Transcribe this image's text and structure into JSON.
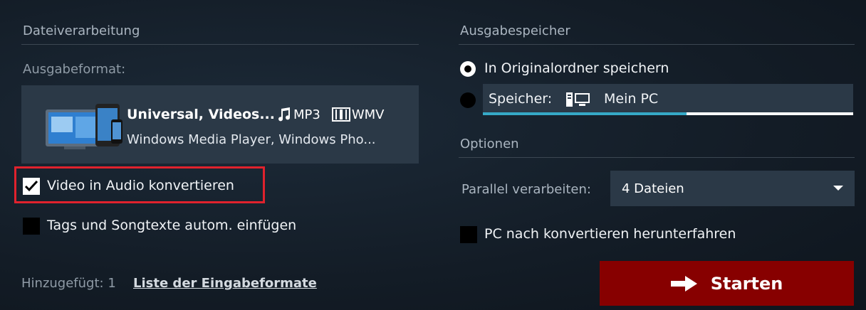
{
  "left": {
    "section_title": "Dateiverarbeitung",
    "format_label": "Ausgabeformat:",
    "format": {
      "title": "Universal, Videos...",
      "tag_mp3": "MP3",
      "tag_wmv": "WMV",
      "subtitle": "Windows Media Player, Windows Pho..."
    },
    "convert_audio": {
      "label": "Video in Audio konvertieren",
      "checked": true
    },
    "tags_lyrics": {
      "label": "Tags und Songtexte autom. einfügen",
      "checked": false
    },
    "added_text": "Hinzugefügt: 1",
    "input_formats_link": "Liste der Eingabeformate"
  },
  "right": {
    "section_title": "Ausgabespeicher",
    "original_folder": {
      "label": "In Originalordner speichern",
      "selected": true
    },
    "storage": {
      "label": "Speicher:",
      "value": "Mein PC",
      "selected": false,
      "usage_fraction": 0.55
    },
    "options_title": "Optionen",
    "parallel": {
      "label": "Parallel verarbeiten:",
      "value": "4 Dateien"
    },
    "shutdown": {
      "label": "PC nach konvertieren herunterfahren",
      "checked": false
    },
    "start_button": "Starten"
  },
  "colors": {
    "background": "#131c26",
    "panel": "#2b3947",
    "highlight": "#e0222d",
    "start": "#870000",
    "progress": "#36a9c7"
  },
  "icons": [
    "checkmark-icon",
    "music-note-icon",
    "film-icon",
    "pc-icon",
    "arrow-right-icon",
    "chevron-down-icon",
    "devices-icon"
  ]
}
